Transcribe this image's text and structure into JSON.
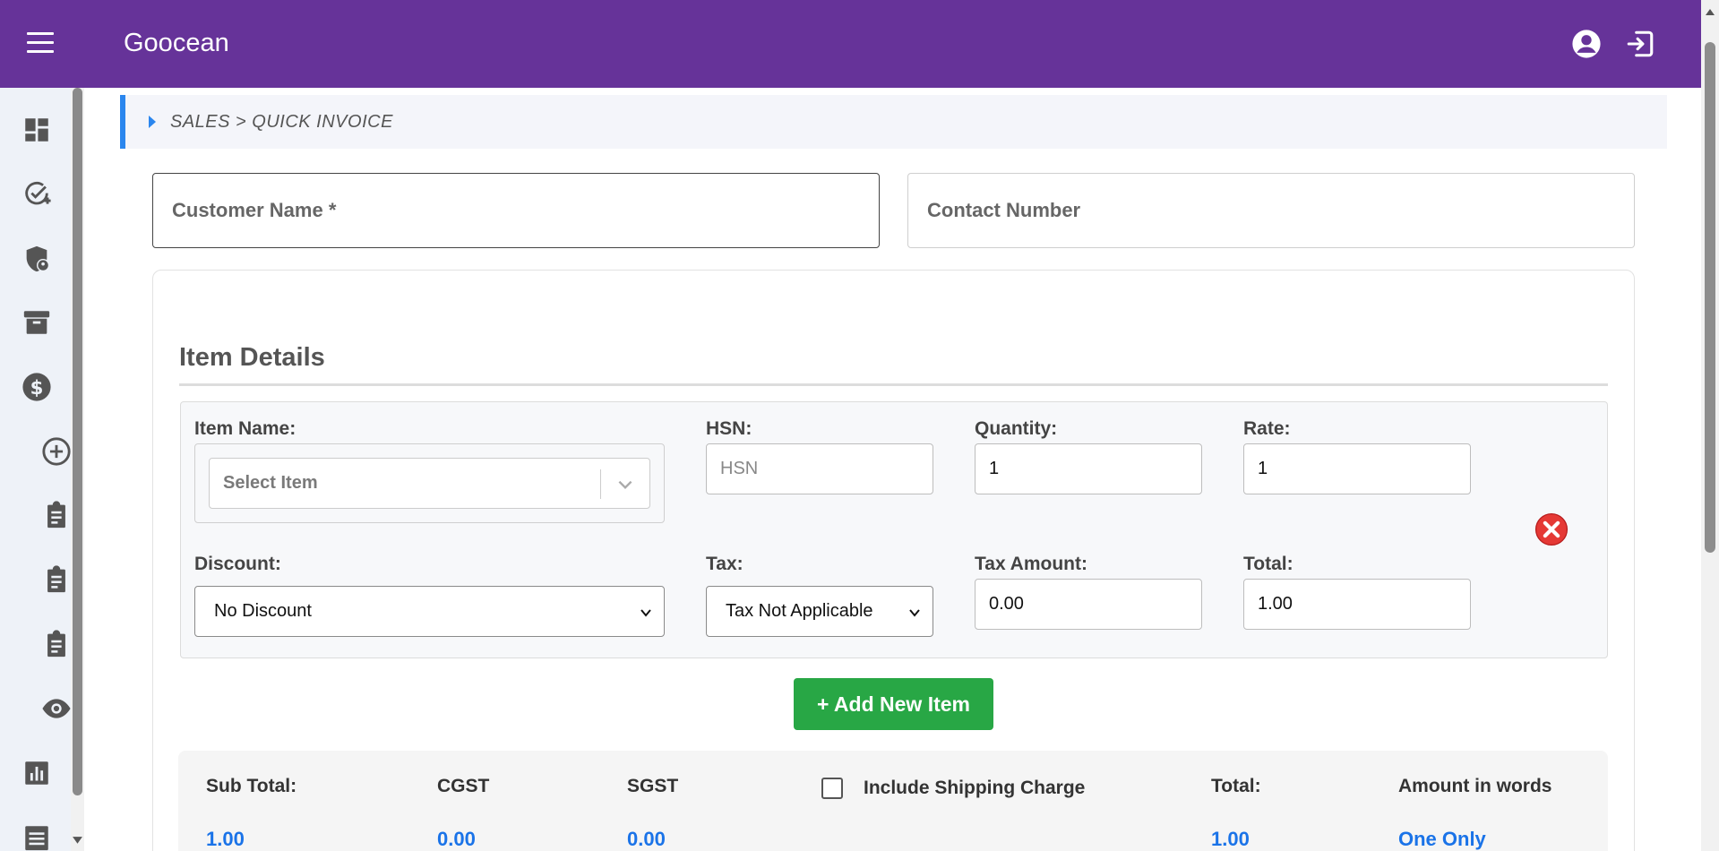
{
  "header": {
    "brand": "Goocean",
    "menu_icon": "hamburger-menu-icon",
    "account_icon": "account-circle-icon",
    "logout_icon": "logout-icon"
  },
  "sidebar": {
    "items": [
      {
        "icon": "dashboard-icon"
      },
      {
        "icon": "task-check-icon"
      },
      {
        "icon": "security-shield-icon"
      },
      {
        "icon": "archive-box-icon"
      },
      {
        "icon": "dollar-coin-icon"
      },
      {
        "icon": "add-circle-icon"
      },
      {
        "icon": "clipboard-icon"
      },
      {
        "icon": "clipboard-icon"
      },
      {
        "icon": "clipboard-icon"
      },
      {
        "icon": "eye-icon"
      },
      {
        "icon": "bar-chart-icon"
      },
      {
        "icon": "list-icon"
      }
    ]
  },
  "breadcrumb": {
    "text": "SALES > QUICK INVOICE"
  },
  "customer": {
    "name_label": "Customer Name *",
    "contact_label": "Contact Number"
  },
  "items_section": {
    "title": "Item Details",
    "item_name_label": "Item Name:",
    "item_select_placeholder": "Select Item",
    "hsn_label": "HSN:",
    "hsn_placeholder": "HSN",
    "quantity_label": "Quantity:",
    "quantity_value": "1",
    "rate_label": "Rate:",
    "rate_value": "1",
    "discount_label": "Discount:",
    "discount_value": "No Discount",
    "tax_label": "Tax:",
    "tax_value": "Tax Not Applicable",
    "tax_amount_label": "Tax Amount:",
    "tax_amount_value": "0.00",
    "total_label": "Total:",
    "total_value": "1.00",
    "remove_icon": "remove-circle-x-icon",
    "add_button": "+ Add New Item"
  },
  "summary": {
    "subtotal_label": "Sub Total:",
    "subtotal_value": "1.00",
    "cgst_label": "CGST",
    "cgst_value": "0.00",
    "sgst_label": "SGST",
    "sgst_value": "0.00",
    "shipping_label": "Include Shipping Charge",
    "total_label": "Total:",
    "total_value": "1.00",
    "words_label": "Amount in words",
    "words_value": "One Only"
  },
  "colors": {
    "header": "#663399",
    "accent": "#2b86ee",
    "add_button": "#28a745",
    "value_blue": "#1a73e8",
    "remove_red": "#e53935"
  }
}
